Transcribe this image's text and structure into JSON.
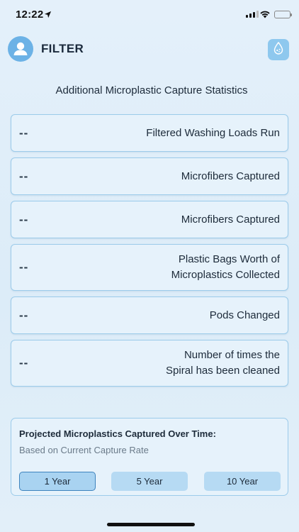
{
  "status_bar": {
    "time": "12:22"
  },
  "header": {
    "title": "FILTER"
  },
  "section_title": "Additional Microplastic Capture Statistics",
  "stats": [
    {
      "value": "--",
      "label_lines": [
        "Filtered Washing Loads Run"
      ]
    },
    {
      "value": "--",
      "label_lines": [
        "Microfibers Captured"
      ]
    },
    {
      "value": "--",
      "label_lines": [
        "Microfibers Captured"
      ]
    },
    {
      "value": "--",
      "label_lines": [
        "Plastic Bags Worth of",
        "Microplastics Collected"
      ]
    },
    {
      "value": "--",
      "label_lines": [
        "Pods Changed"
      ]
    },
    {
      "value": "--",
      "label_lines": [
        "Number of times the",
        "Spiral has been cleaned"
      ]
    }
  ],
  "projection": {
    "title": "Projected Microplastics Captured Over Time:",
    "subtitle": "Based on Current Capture Rate",
    "options": [
      "1 Year",
      "5 Year",
      "10 Year"
    ],
    "selected": "1 Year"
  },
  "colors": {
    "accent": "#6cb2e6",
    "card_bg": "#e6f2fb",
    "card_border": "#9ccbea",
    "button": "#b6daf3",
    "selected_border": "#3e83bd"
  },
  "icons": [
    "location-arrow-icon",
    "cellular-signal-icon",
    "wifi-icon",
    "battery-icon",
    "user-avatar-icon",
    "water-drop-icon"
  ]
}
